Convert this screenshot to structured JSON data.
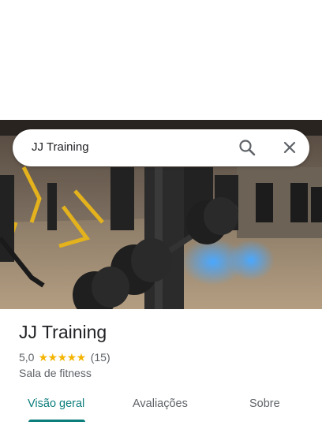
{
  "search": {
    "query": "JJ Training",
    "search_icon": "search-icon",
    "close_icon": "close-icon"
  },
  "place": {
    "name": "JJ Training",
    "rating": "5,0",
    "stars": "★★★★★",
    "review_count": "(15)",
    "category": "Sala de fitness"
  },
  "tabs": [
    {
      "label": "Visão geral",
      "active": true
    },
    {
      "label": "Avaliações",
      "active": false
    },
    {
      "label": "Sobre",
      "active": false
    }
  ],
  "colors": {
    "accent": "#0b7d7b",
    "star": "#f4b400",
    "secondary_text": "#5f6368"
  }
}
